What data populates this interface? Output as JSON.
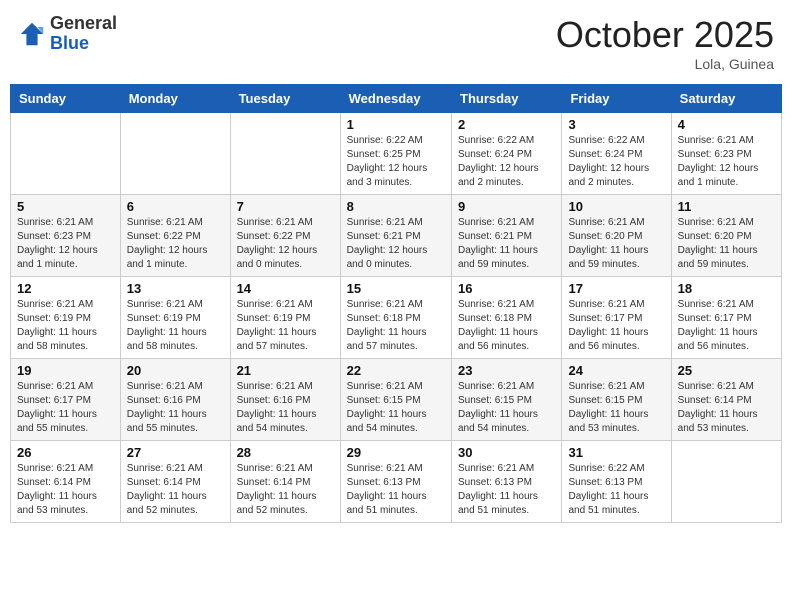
{
  "header": {
    "logo_general": "General",
    "logo_blue": "Blue",
    "month_title": "October 2025",
    "location": "Lola, Guinea"
  },
  "weekdays": [
    "Sunday",
    "Monday",
    "Tuesday",
    "Wednesday",
    "Thursday",
    "Friday",
    "Saturday"
  ],
  "weeks": [
    [
      {
        "day": "",
        "info": ""
      },
      {
        "day": "",
        "info": ""
      },
      {
        "day": "",
        "info": ""
      },
      {
        "day": "1",
        "info": "Sunrise: 6:22 AM\nSunset: 6:25 PM\nDaylight: 12 hours and 3 minutes."
      },
      {
        "day": "2",
        "info": "Sunrise: 6:22 AM\nSunset: 6:24 PM\nDaylight: 12 hours and 2 minutes."
      },
      {
        "day": "3",
        "info": "Sunrise: 6:22 AM\nSunset: 6:24 PM\nDaylight: 12 hours and 2 minutes."
      },
      {
        "day": "4",
        "info": "Sunrise: 6:21 AM\nSunset: 6:23 PM\nDaylight: 12 hours and 1 minute."
      }
    ],
    [
      {
        "day": "5",
        "info": "Sunrise: 6:21 AM\nSunset: 6:23 PM\nDaylight: 12 hours and 1 minute."
      },
      {
        "day": "6",
        "info": "Sunrise: 6:21 AM\nSunset: 6:22 PM\nDaylight: 12 hours and 1 minute."
      },
      {
        "day": "7",
        "info": "Sunrise: 6:21 AM\nSunset: 6:22 PM\nDaylight: 12 hours and 0 minutes."
      },
      {
        "day": "8",
        "info": "Sunrise: 6:21 AM\nSunset: 6:21 PM\nDaylight: 12 hours and 0 minutes."
      },
      {
        "day": "9",
        "info": "Sunrise: 6:21 AM\nSunset: 6:21 PM\nDaylight: 11 hours and 59 minutes."
      },
      {
        "day": "10",
        "info": "Sunrise: 6:21 AM\nSunset: 6:20 PM\nDaylight: 11 hours and 59 minutes."
      },
      {
        "day": "11",
        "info": "Sunrise: 6:21 AM\nSunset: 6:20 PM\nDaylight: 11 hours and 59 minutes."
      }
    ],
    [
      {
        "day": "12",
        "info": "Sunrise: 6:21 AM\nSunset: 6:19 PM\nDaylight: 11 hours and 58 minutes."
      },
      {
        "day": "13",
        "info": "Sunrise: 6:21 AM\nSunset: 6:19 PM\nDaylight: 11 hours and 58 minutes."
      },
      {
        "day": "14",
        "info": "Sunrise: 6:21 AM\nSunset: 6:19 PM\nDaylight: 11 hours and 57 minutes."
      },
      {
        "day": "15",
        "info": "Sunrise: 6:21 AM\nSunset: 6:18 PM\nDaylight: 11 hours and 57 minutes."
      },
      {
        "day": "16",
        "info": "Sunrise: 6:21 AM\nSunset: 6:18 PM\nDaylight: 11 hours and 56 minutes."
      },
      {
        "day": "17",
        "info": "Sunrise: 6:21 AM\nSunset: 6:17 PM\nDaylight: 11 hours and 56 minutes."
      },
      {
        "day": "18",
        "info": "Sunrise: 6:21 AM\nSunset: 6:17 PM\nDaylight: 11 hours and 56 minutes."
      }
    ],
    [
      {
        "day": "19",
        "info": "Sunrise: 6:21 AM\nSunset: 6:17 PM\nDaylight: 11 hours and 55 minutes."
      },
      {
        "day": "20",
        "info": "Sunrise: 6:21 AM\nSunset: 6:16 PM\nDaylight: 11 hours and 55 minutes."
      },
      {
        "day": "21",
        "info": "Sunrise: 6:21 AM\nSunset: 6:16 PM\nDaylight: 11 hours and 54 minutes."
      },
      {
        "day": "22",
        "info": "Sunrise: 6:21 AM\nSunset: 6:15 PM\nDaylight: 11 hours and 54 minutes."
      },
      {
        "day": "23",
        "info": "Sunrise: 6:21 AM\nSunset: 6:15 PM\nDaylight: 11 hours and 54 minutes."
      },
      {
        "day": "24",
        "info": "Sunrise: 6:21 AM\nSunset: 6:15 PM\nDaylight: 11 hours and 53 minutes."
      },
      {
        "day": "25",
        "info": "Sunrise: 6:21 AM\nSunset: 6:14 PM\nDaylight: 11 hours and 53 minutes."
      }
    ],
    [
      {
        "day": "26",
        "info": "Sunrise: 6:21 AM\nSunset: 6:14 PM\nDaylight: 11 hours and 53 minutes."
      },
      {
        "day": "27",
        "info": "Sunrise: 6:21 AM\nSunset: 6:14 PM\nDaylight: 11 hours and 52 minutes."
      },
      {
        "day": "28",
        "info": "Sunrise: 6:21 AM\nSunset: 6:14 PM\nDaylight: 11 hours and 52 minutes."
      },
      {
        "day": "29",
        "info": "Sunrise: 6:21 AM\nSunset: 6:13 PM\nDaylight: 11 hours and 51 minutes."
      },
      {
        "day": "30",
        "info": "Sunrise: 6:21 AM\nSunset: 6:13 PM\nDaylight: 11 hours and 51 minutes."
      },
      {
        "day": "31",
        "info": "Sunrise: 6:22 AM\nSunset: 6:13 PM\nDaylight: 11 hours and 51 minutes."
      },
      {
        "day": "",
        "info": ""
      }
    ]
  ]
}
